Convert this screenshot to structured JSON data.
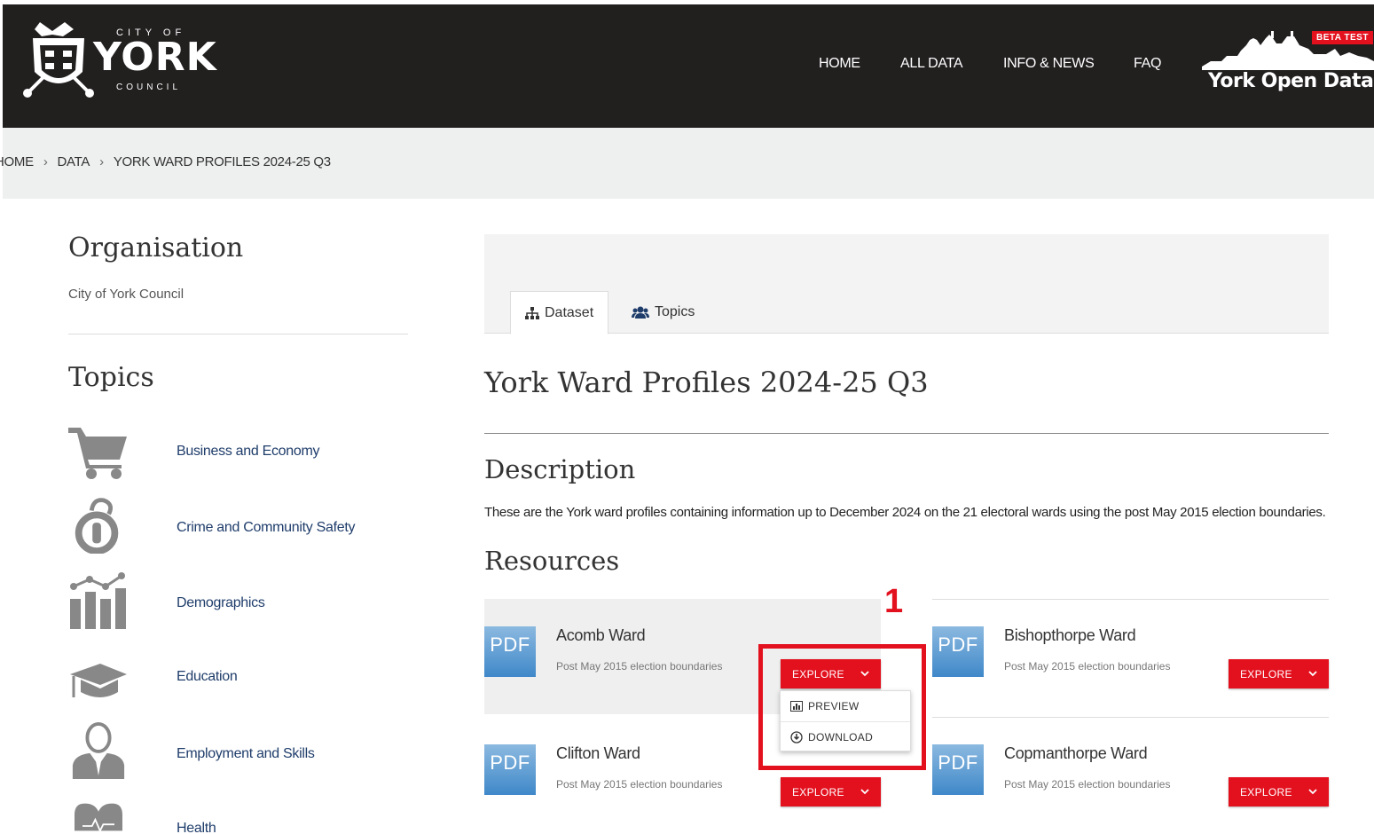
{
  "header": {
    "logo": {
      "city_of": "CITY OF",
      "york": "YORK",
      "council": "COUNCIL"
    },
    "nav": [
      {
        "label": "HOME"
      },
      {
        "label": "ALL DATA"
      },
      {
        "label": "INFO & NEWS"
      },
      {
        "label": "FAQ"
      }
    ],
    "brand": {
      "label": "York Open Data",
      "badge": "BETA TEST"
    }
  },
  "breadcrumb": {
    "items": [
      "HOME",
      "DATA",
      "YORK WARD PROFILES 2024-25 Q3"
    ]
  },
  "sidebar": {
    "organisation_title": "Organisation",
    "organisation": "City of York Council",
    "topics_title": "Topics",
    "topics": [
      {
        "label": "Business and Economy",
        "icon": "shopping-cart-icon"
      },
      {
        "label": "Crime and Community Safety",
        "icon": "handcuffs-icon"
      },
      {
        "label": "Demographics",
        "icon": "bar-chart-icon"
      },
      {
        "label": "Education",
        "icon": "graduation-cap-icon"
      },
      {
        "label": "Employment and Skills",
        "icon": "businessman-icon"
      },
      {
        "label": "Health",
        "icon": "heart-pulse-icon"
      }
    ]
  },
  "tabs": [
    {
      "label": "Dataset",
      "icon": "sitemap-icon",
      "active": true
    },
    {
      "label": "Topics",
      "icon": "users-icon",
      "active": false
    }
  ],
  "main": {
    "title": "York Ward Profiles 2024-25 Q3",
    "description_title": "Description",
    "description": "These are the York ward profiles containing information up to December 2024 on the 21 electoral wards using the post May 2015 election boundaries.",
    "resources_title": "Resources"
  },
  "resources": [
    {
      "name": "Acomb Ward",
      "format": "PDF",
      "subtitle": "Post May 2015 election boundaries",
      "button": "EXPLORE"
    },
    {
      "name": "Bishopthorpe Ward",
      "format": "PDF",
      "subtitle": "Post May 2015 election boundaries",
      "button": "EXPLORE"
    },
    {
      "name": "Clifton Ward",
      "format": "PDF",
      "subtitle": "Post May 2015 election boundaries",
      "button": "EXPLORE"
    },
    {
      "name": "Copmanthorpe Ward",
      "format": "PDF",
      "subtitle": "Post May 2015 election boundaries",
      "button": "EXPLORE"
    }
  ],
  "dropdown": {
    "items": [
      {
        "label": "PREVIEW",
        "icon": "preview-icon"
      },
      {
        "label": "DOWNLOAD",
        "icon": "download-icon"
      }
    ]
  },
  "annotation": {
    "number": "1"
  },
  "colors": {
    "header_bg": "#221f1f",
    "accent_red": "#e3101e",
    "link": "#1f3d6b",
    "breadcrumb_bg": "#eef0ef"
  }
}
